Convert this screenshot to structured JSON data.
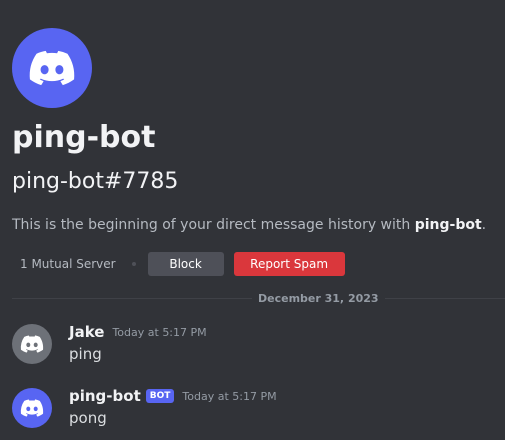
{
  "profile": {
    "name": "ping-bot",
    "tag": "ping-bot#7785",
    "intro_prefix": "This is the beginning of your direct message history with ",
    "intro_name": "ping-bot",
    "intro_suffix": "."
  },
  "actions": {
    "mutual_servers": "1 Mutual Server",
    "block_label": "Block",
    "report_label": "Report Spam"
  },
  "divider": {
    "date": "December 31, 2023"
  },
  "messages": [
    {
      "author": "Jake",
      "time": "Today at 5:17 PM",
      "text": "ping",
      "avatar_color": "#6d7178"
    },
    {
      "author": "ping-bot",
      "bot_tag": "BOT",
      "time": "Today at 5:17 PM",
      "text": "pong",
      "avatar_color": "#5865f2"
    }
  ],
  "colors": {
    "background": "#313338",
    "brand": "#5865f2",
    "danger": "#da373c",
    "secondary_button": "#4e5058"
  },
  "icons": {
    "profile_avatar": "discord-logo-icon",
    "message_avatar": "discord-logo-icon"
  }
}
